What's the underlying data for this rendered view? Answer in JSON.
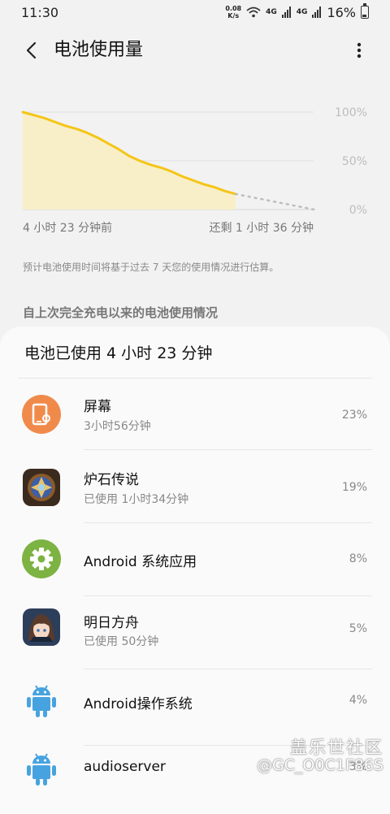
{
  "status_bar": {
    "time": "11:30",
    "net_speed_value": "0.08",
    "net_speed_unit": "K/s",
    "network_type_1": "4G",
    "network_type_2": "4G",
    "battery_level": "16%"
  },
  "header": {
    "title": "电池使用量",
    "back_icon": "chevron-left-icon",
    "more_icon": "more-vertical-icon"
  },
  "battery_chart": {
    "y_ticks": [
      "100%",
      "50%",
      "0%"
    ],
    "start_label": "4 小时 23 分钟前",
    "end_label": "还剩 1 小时 36 分钟",
    "line_color": "#f5c518",
    "fill_color": "#f8efc8",
    "series": [
      {
        "t": 0.0,
        "level": 100
      },
      {
        "t": 0.05,
        "level": 97
      },
      {
        "t": 0.1,
        "level": 94
      },
      {
        "t": 0.15,
        "level": 90
      },
      {
        "t": 0.2,
        "level": 86
      },
      {
        "t": 0.25,
        "level": 83
      },
      {
        "t": 0.3,
        "level": 79
      },
      {
        "t": 0.35,
        "level": 74
      },
      {
        "t": 0.4,
        "level": 68
      },
      {
        "t": 0.45,
        "level": 62
      },
      {
        "t": 0.5,
        "level": 55
      },
      {
        "t": 0.55,
        "level": 50
      },
      {
        "t": 0.6,
        "level": 46
      },
      {
        "t": 0.65,
        "level": 43
      },
      {
        "t": 0.7,
        "level": 39
      },
      {
        "t": 0.75,
        "level": 34
      },
      {
        "t": 0.8,
        "level": 30
      },
      {
        "t": 0.85,
        "level": 26
      },
      {
        "t": 0.9,
        "level": 23
      },
      {
        "t": 0.95,
        "level": 19
      },
      {
        "t": 1.0,
        "level": 16
      }
    ],
    "projection": [
      {
        "t": 1.0,
        "level": 16
      },
      {
        "t": 1.37,
        "level": 0
      }
    ]
  },
  "estimate_note": "预计电池使用时间将基于过去 7 天您的使用情况进行估算。",
  "section_header": "自上次完全充电以来的电池使用情况",
  "usage": {
    "summary": "电池已使用 4 小时 23 分钟",
    "apps": [
      {
        "name": "屏幕",
        "subtitle": "3小时56分钟",
        "percent": "23%",
        "icon": "screen-icon",
        "icon_color": "#f08a4b"
      },
      {
        "name": "炉石传说",
        "subtitle": "已使用 1小时34分钟",
        "percent": "19%",
        "icon": "hearthstone-icon",
        "icon_color": "#3c5fa8"
      },
      {
        "name": "Android 系统应用",
        "subtitle": "",
        "percent": "8%",
        "icon": "gear-icon",
        "icon_color": "#7cb342"
      },
      {
        "name": "明日方舟",
        "subtitle": "已使用 50分钟",
        "percent": "5%",
        "icon": "arknights-icon",
        "icon_color": "#2c3e5a"
      },
      {
        "name": "Android操作系统",
        "subtitle": "",
        "percent": "4%",
        "icon": "android-icon",
        "icon_color": "#47a3e0"
      },
      {
        "name": "audioserver",
        "subtitle": "",
        "percent": "3%",
        "icon": "android-icon",
        "icon_color": "#47a3e0"
      }
    ]
  },
  "watermark": {
    "title": "盖乐世社区",
    "user": "@GC_O0C1F86S"
  }
}
